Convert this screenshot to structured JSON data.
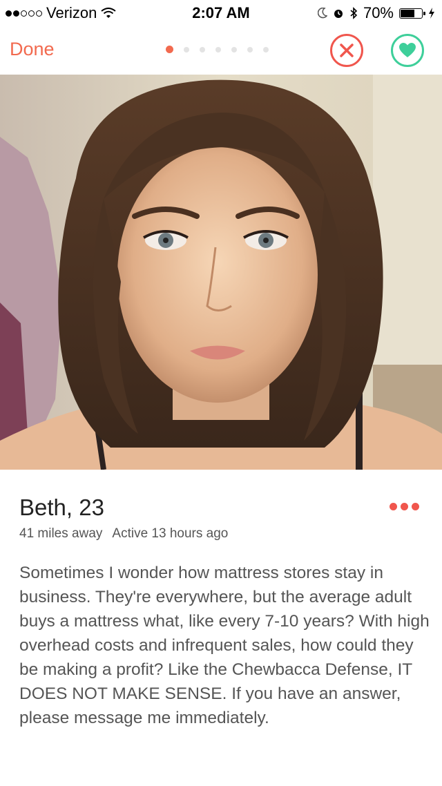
{
  "status_bar": {
    "carrier": "Verizon",
    "time": "2:07 AM",
    "battery": "70%",
    "battery_level": 0.7,
    "signal_bars_filled": 2,
    "signal_bars_total": 5
  },
  "nav": {
    "done_label": "Done",
    "photo_count": 7,
    "active_photo_index": 0,
    "accent_color": "#f26a4f",
    "nope_color": "#f0564d",
    "like_color": "#3ecf9a"
  },
  "profile": {
    "name_age": "Beth, 23",
    "distance": "41 miles away",
    "active": "Active 13 hours ago",
    "bio": "Sometimes I wonder how mattress stores stay in business. They're everywhere, but the average adult buys a mattress what, like every 7-10 years?  With high overhead costs and infrequent sales, how could they be making a profit? Like the Chewbacca Defense, IT DOES NOT MAKE SENSE. If you have an answer, please message me immediately."
  },
  "icons": {
    "nope": "x-icon",
    "like": "heart-icon",
    "more": "ellipsis-icon",
    "wifi": "wifi-icon",
    "moon": "moon-icon",
    "alarm": "alarm-icon",
    "bluetooth": "bluetooth-icon",
    "charging": "bolt-icon"
  }
}
